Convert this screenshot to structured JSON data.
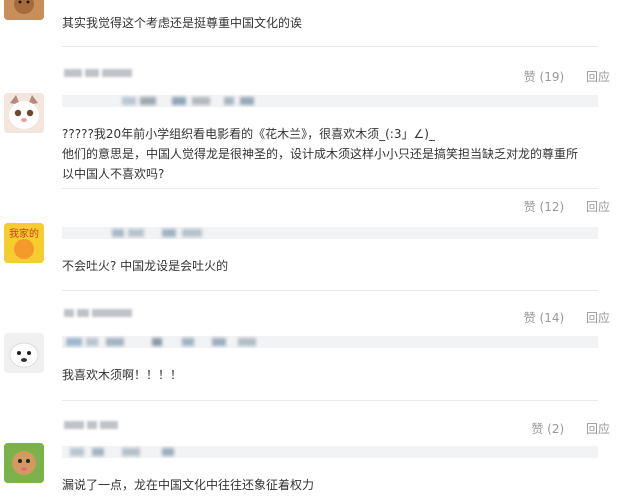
{
  "comments": [
    {
      "username": "",
      "text": "其实我觉得这个考虑还是挺尊重中国文化的诶"
    },
    {
      "username": "",
      "likes": "赞 (19)",
      "reply": "回应",
      "text_lines": [
        "?????我20年前小学组织看电影看的《花木兰》，很喜欢木须_(:3」∠)_",
        "他们的意思是，中国人觉得龙是很神圣的，设计成木须这样小小只还是搞笑担当缺乏对龙的尊重所",
        "以中国人不喜欢吗?"
      ]
    },
    {
      "username": "",
      "likes": "赞 (12)",
      "reply": "回应",
      "text": "不会吐火? 中国龙设是会吐火的"
    },
    {
      "username": "",
      "likes": "赞 (14)",
      "reply": "回应",
      "text": "我喜欢木须啊！！！！"
    },
    {
      "username": "",
      "likes": "赞 (2)",
      "reply": "回应",
      "text": "漏说了一点，龙在中国文化中往往还象征着权力"
    }
  ]
}
